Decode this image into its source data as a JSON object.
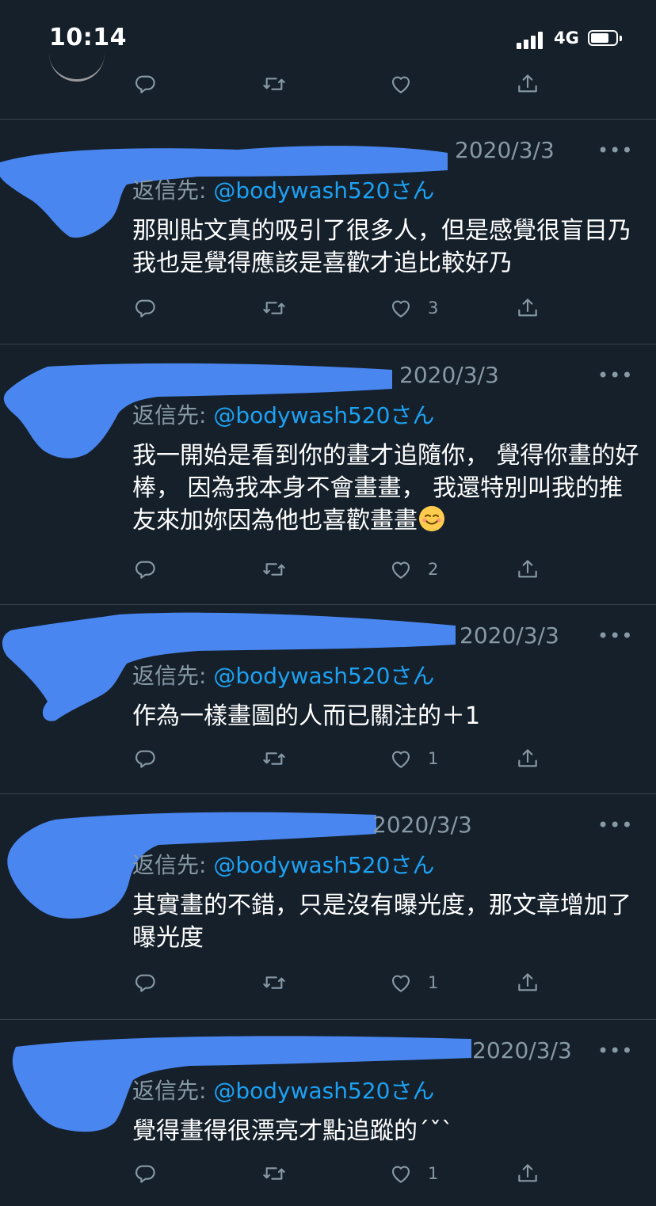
{
  "status_bar": {
    "time": "10:14",
    "network": "4G"
  },
  "reply_prefix": "返信先: ",
  "handle": "@bodywash520さん",
  "tweets": [
    {
      "date": "2020/3/3",
      "more": "•••",
      "text": "那則貼文真的吸引了很多人，但是感覺很盲目乃我也是覺得應該是喜歡才追比較好乃",
      "likes": "3"
    },
    {
      "date": "2020/3/3",
      "more": "•••",
      "text": "我一開始是看到你的畫才追隨你， 覺得你畫的好棒， 因為我本身不會畫畫， 我還特別叫我的推友來加妳因為他也喜歡畫畫",
      "emoji": "smiling-face-emoji",
      "likes": "2"
    },
    {
      "date": "2020/3/3",
      "more": "•••",
      "text": "作為一樣畫圖的人而已關注的＋1",
      "likes": "1"
    },
    {
      "date": "2020/3/3",
      "more": "•••",
      "text": "其實畫的不錯，只是沒有曝光度，那文章增加了曝光度",
      "likes": "1"
    },
    {
      "date": "2020/3/3",
      "more": "•••",
      "text": "覺得畫得很漂亮才點追蹤的´ˇ`",
      "likes": "1"
    }
  ],
  "icons": {
    "reply": "reply-icon",
    "retweet": "retweet-icon",
    "like": "heart-icon",
    "share": "share-icon"
  },
  "colors": {
    "background": "#15202b",
    "text": "#ffffff",
    "secondary": "#8899a6",
    "link": "#1da1f2",
    "redaction": "#4a86f0"
  }
}
